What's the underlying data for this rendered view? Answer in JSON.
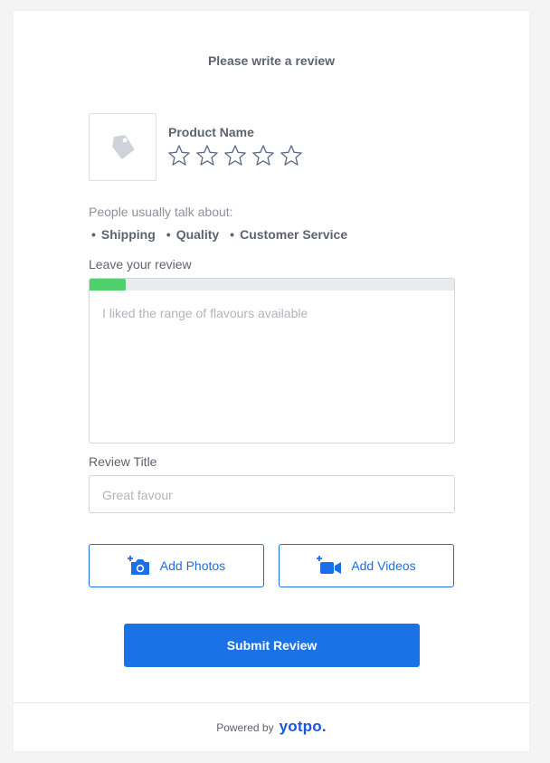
{
  "form": {
    "title": "Please write a review",
    "product_name": "Product Name",
    "rating_max": 5,
    "rating_selected": 0,
    "talk_label": "People usually talk about:",
    "topics": [
      "Shipping",
      "Quality",
      "Customer Service"
    ],
    "review_label": "Leave your review",
    "review_placeholder": "I liked the range of flavours available",
    "review_progress": 0.1,
    "title_label": "Review Title",
    "title_placeholder": "Great favour",
    "add_photos_label": "Add Photos",
    "add_videos_label": "Add Videos",
    "submit_label": "Submit Review"
  },
  "footer": {
    "powered_by": "Powered by",
    "brand": "yotpo."
  },
  "colors": {
    "accent": "#1a72e6",
    "progress": "#4fd06c",
    "text": "#5d6370",
    "placeholder": "#b0b5bc"
  },
  "icons": {
    "product": "tag-icon",
    "photos": "camera-plus-icon",
    "videos": "video-plus-icon",
    "star": "star-outline-icon"
  }
}
